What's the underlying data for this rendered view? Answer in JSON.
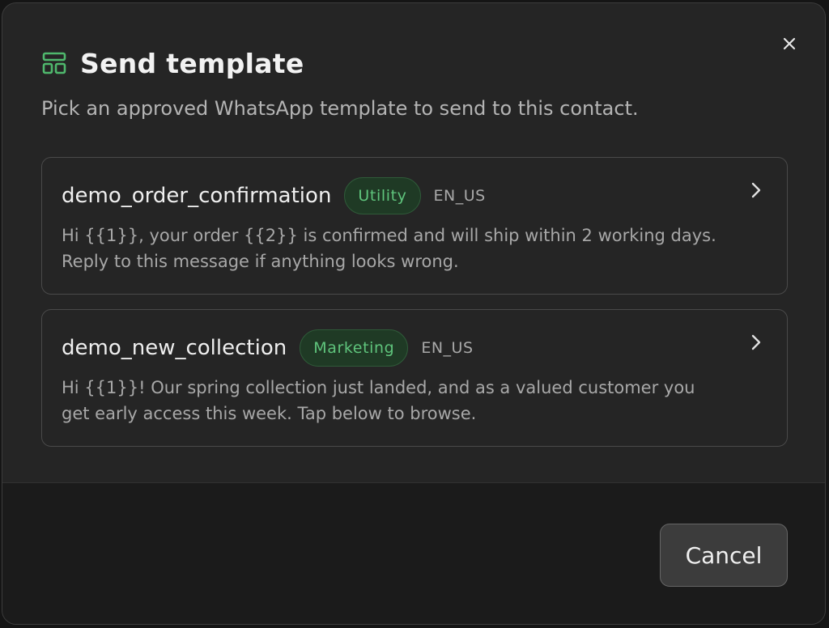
{
  "dialog": {
    "title": "Send template",
    "subtitle": "Pick an approved WhatsApp template to send to this contact.",
    "close_icon": "close-icon",
    "title_icon": "template-layout-icon"
  },
  "templates": [
    {
      "name": "demo_order_confirmation",
      "category": "Utility",
      "language": "EN_US",
      "body": "Hi {{1}}, your order {{2}} is confirmed and will ship within 2 working days. Reply to this message if anything looks wrong."
    },
    {
      "name": "demo_new_collection",
      "category": "Marketing",
      "language": "EN_US",
      "body": "Hi {{1}}! Our spring collection just landed, and as a valued customer you get early access this week. Tap below to browse."
    }
  ],
  "footer": {
    "cancel_label": "Cancel"
  },
  "colors": {
    "accent_green": "#5fc47c",
    "modal_bg": "#252525",
    "footer_bg": "#1b1b1b"
  }
}
